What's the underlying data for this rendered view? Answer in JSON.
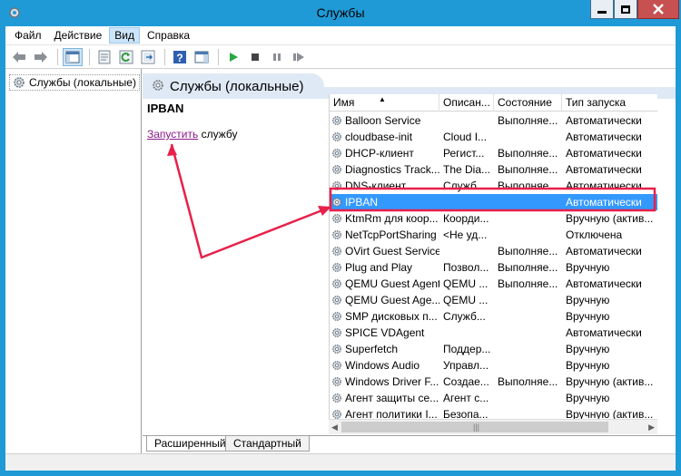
{
  "window": {
    "title": "Службы"
  },
  "menu": [
    "Файл",
    "Действие",
    "Вид",
    "Справка"
  ],
  "tree": {
    "root_label": "Службы (локальные)"
  },
  "pane": {
    "title": "Службы (локальные)",
    "selected_service": "IPBAN",
    "start_link": "Запустить",
    "start_suffix": " службу"
  },
  "columns": [
    "Имя",
    "Описан...",
    "Состояние",
    "Тип запуска"
  ],
  "services": [
    [
      "Balloon Service",
      "",
      "Выполняе...",
      "Автоматически"
    ],
    [
      "cloudbase-init",
      "Cloud I...",
      "",
      "Автоматически"
    ],
    [
      "DHCP-клиент",
      "Регист...",
      "Выполняе...",
      "Автоматически"
    ],
    [
      "Diagnostics Track...",
      "The Dia...",
      "Выполняе...",
      "Автоматически"
    ],
    [
      "DNS-клиент",
      "Служб...",
      "Выполняе...",
      "Автоматически"
    ],
    [
      "IPBAN",
      "",
      "",
      "Автоматически"
    ],
    [
      "KtmRm для коор...",
      "Коорди...",
      "",
      "Вручную (актив..."
    ],
    [
      "NetTcpPortSharing",
      "<Не уд...",
      "",
      "Отключена"
    ],
    [
      "OVirt Guest Service",
      "",
      "Выполняе...",
      "Автоматически"
    ],
    [
      "Plug and Play",
      "Позвол...",
      "Выполняе...",
      "Вручную"
    ],
    [
      "QEMU Guest Agent",
      "QEMU ...",
      "Выполняе...",
      "Автоматически"
    ],
    [
      "QEMU Guest Age...",
      "QEMU ...",
      "",
      "Вручную"
    ],
    [
      "SMP дисковых п...",
      "Служб...",
      "",
      "Вручную"
    ],
    [
      "SPICE VDAgent",
      "",
      "",
      "Автоматически"
    ],
    [
      "Superfetch",
      "Поддер...",
      "",
      "Вручную"
    ],
    [
      "Windows Audio",
      "Управл...",
      "",
      "Вручную"
    ],
    [
      "Windows Driver F...",
      "Создае...",
      "Выполняе...",
      "Вручную (актив..."
    ],
    [
      "Агент защиты се...",
      "Агент с...",
      "",
      "Вручную"
    ],
    [
      "Агент политики I...",
      "Безопа...",
      "",
      "Вручную (актив..."
    ]
  ],
  "selected_index": 5,
  "tabs": [
    "Расширенный",
    "Стандартный"
  ],
  "colors": {
    "titlebar": "#1f9ad6",
    "selection": "#3399ff",
    "annotation": "#e8204a",
    "link": "#8b1a8b"
  }
}
